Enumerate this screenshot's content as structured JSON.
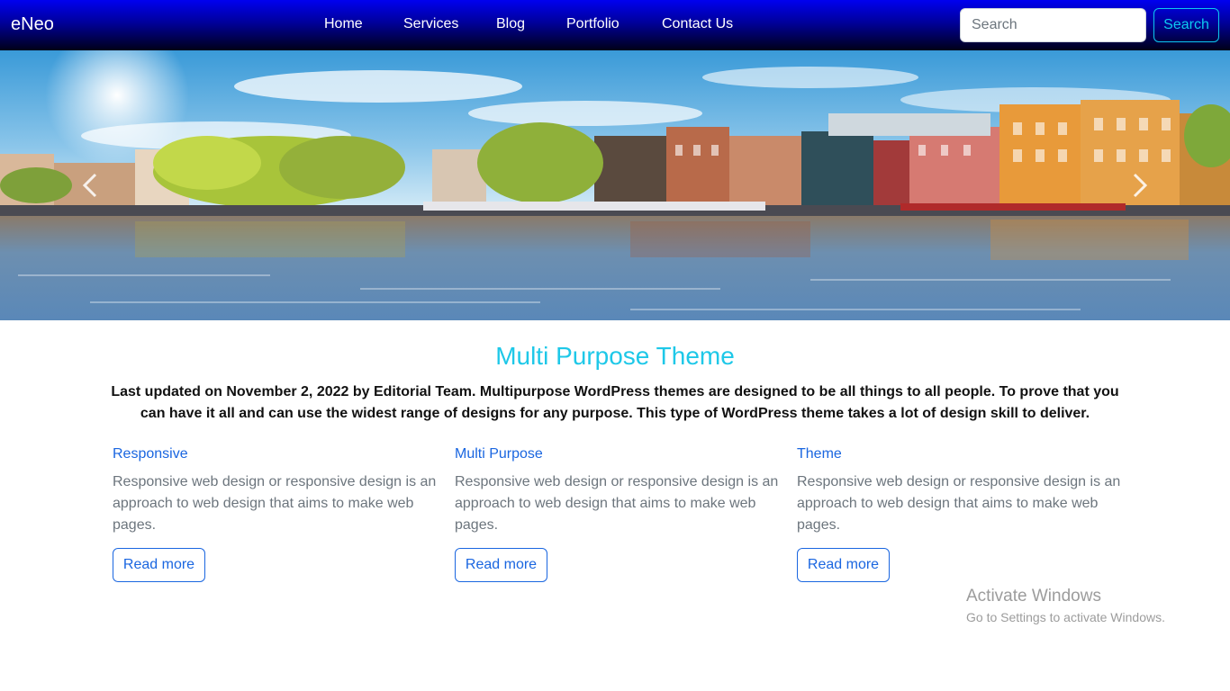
{
  "navbar": {
    "brand": "eNeo",
    "links": [
      "Home",
      "Services",
      "Blog",
      "Portfolio",
      "Contact Us"
    ],
    "search_placeholder": "Search",
    "search_button": "Search"
  },
  "hero": {
    "image": "amsterdam-canal-houses-photo"
  },
  "content": {
    "title": "Multi Purpose Theme",
    "intro": "Last updated on November 2, 2022 by Editorial Team. Multipurpose WordPress themes are designed to be all things to all people. To prove that you can have it all and can use the widest range of designs for any purpose. This type of WordPress theme takes a lot of design skill to deliver.",
    "features": [
      {
        "title": "Responsive",
        "text": "Responsive web design or responsive design is an approach to web design that aims to make web pages.",
        "button": "Read more"
      },
      {
        "title": "Multi Purpose",
        "text": "Responsive web design or responsive design is an approach to web design that aims to make web pages.",
        "button": "Read more"
      },
      {
        "title": "Theme",
        "text": "Responsive web design or responsive design is an approach to web design that aims to make web pages.",
        "button": "Read more"
      }
    ]
  },
  "watermark": {
    "title": "Activate Windows",
    "subtitle": "Go to Settings to activate Windows."
  },
  "colors": {
    "navbar_top": "#0000f0",
    "navbar_bottom": "#000018",
    "title": "#1ec8e8",
    "link_blue": "#1a66e0",
    "search_accent": "#0dcaf0"
  }
}
